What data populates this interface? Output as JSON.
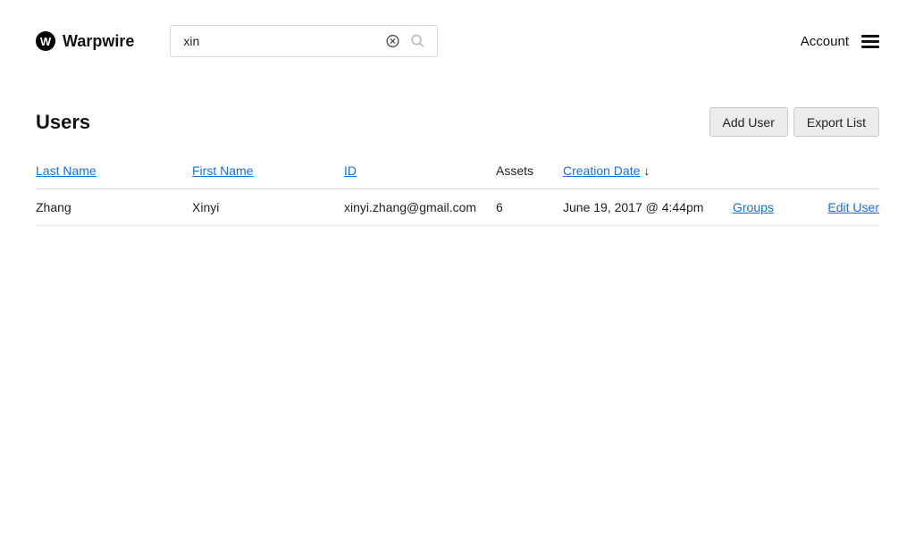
{
  "brand": {
    "name": "Warpwire",
    "mark": "W"
  },
  "search": {
    "value": "xin"
  },
  "header": {
    "account_label": "Account"
  },
  "page": {
    "title": "Users"
  },
  "buttons": {
    "add_user": "Add User",
    "export_list": "Export List"
  },
  "columns": {
    "last_name": "Last Name",
    "first_name": "First Name",
    "id": "ID",
    "assets": "Assets",
    "creation_date": "Creation Date",
    "sort_arrow": "↓"
  },
  "rows": [
    {
      "last_name": "Zhang",
      "first_name": "Xinyi",
      "id": "xinyi.zhang@gmail.com",
      "assets": "6",
      "creation_date": "June 19, 2017 @ 4:44pm",
      "groups_label": "Groups",
      "edit_label": "Edit User"
    }
  ]
}
